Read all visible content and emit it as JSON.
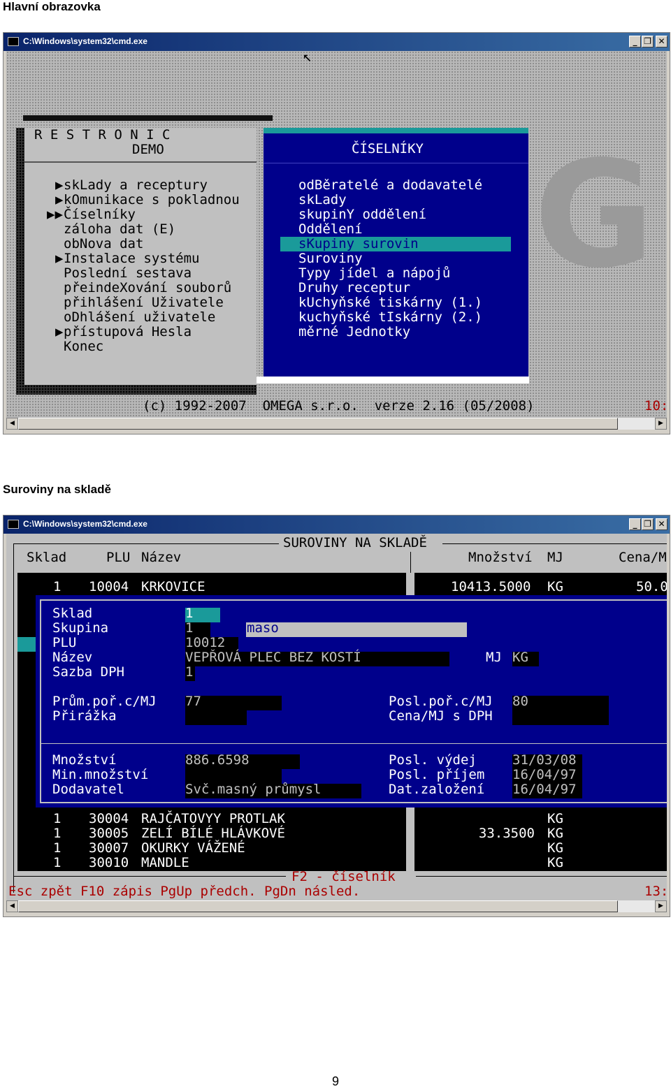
{
  "screen1": {
    "heading": "Hlavní obrazovka",
    "window_title": "C:\\Windows\\system32\\cmd.exe",
    "app_title": "R E S T R O N I C",
    "app_subtitle": "DEMO",
    "main_menu": [
      {
        "marker": "▶",
        "label": "skLady a receptury"
      },
      {
        "marker": "▶",
        "label": "kOmunikace s pokladnou"
      },
      {
        "marker": "▶▶",
        "label": "Číselníky"
      },
      {
        "marker": "",
        "label": "záloha dat (E)"
      },
      {
        "marker": "",
        "label": "obNova dat"
      },
      {
        "marker": "▶",
        "label": "Instalace systému"
      },
      {
        "marker": "",
        "label": "Poslední sestava"
      },
      {
        "marker": "",
        "label": "přeindeXování souborů"
      },
      {
        "marker": "",
        "label": "přihlášení Uživatele"
      },
      {
        "marker": "",
        "label": "oDhlášení uživatele"
      },
      {
        "marker": "▶",
        "label": "přístupová Hesla"
      },
      {
        "marker": "",
        "label": "Konec"
      }
    ],
    "submenu_title": "ČÍSELNÍKY",
    "submenu": [
      {
        "label": "odBěratelé a dodavatelé",
        "selected": false
      },
      {
        "label": "skLady",
        "selected": false
      },
      {
        "label": "skupinY oddělení",
        "selected": false
      },
      {
        "label": "Oddělení",
        "selected": false
      },
      {
        "label": "sKupiny surovin",
        "selected": true
      },
      {
        "label": "Suroviny",
        "selected": false
      },
      {
        "label": "Typy jídel a nápojů",
        "selected": false
      },
      {
        "label": "Druhy receptur",
        "selected": false
      },
      {
        "label": "kUchyňské tiskárny (1.)",
        "selected": false
      },
      {
        "label": "kuchyňské tIskárny (2.)",
        "selected": false
      },
      {
        "label": "měrné Jednotky",
        "selected": false
      }
    ],
    "footer_text": "(c) 1992-2007  OMEGA s.r.o.  verze 2.16 (05/2008)",
    "clock": "10:",
    "background_logo": "GP"
  },
  "screen2": {
    "heading": "Suroviny na skladě",
    "window_title": "C:\\Windows\\system32\\cmd.exe",
    "panel_title": "SUROVINY NA SKLADĚ",
    "columns": {
      "sklad": "Sklad",
      "plu": "PLU",
      "nazev": "Název",
      "mnozstvi": "Množství",
      "mj": "MJ",
      "cena": "Cena/M"
    },
    "top_row": {
      "sklad": "1",
      "plu": "10004",
      "nazev": "KRKOVICE",
      "mnozstvi": "10413.5000",
      "mj": "KG",
      "cena": "50.0"
    },
    "detail": {
      "sklad_label": "Sklad",
      "sklad_value": "1",
      "skupina_label": "Skupina",
      "skupina_value": "1",
      "skupina_name": "maso",
      "plu_label": "PLU",
      "plu_value": "10012",
      "nazev_label": "Název",
      "nazev_value": "VEPŘOVÁ PLEC BEZ KOSTÍ",
      "mj_label": "MJ",
      "mj_value": "KG",
      "dph_label": "Sazba DPH",
      "dph_value": "1",
      "prum_label": "Prům.poř.c/MJ",
      "prum_value": "77",
      "posl_por_label": "Posl.poř.c/MJ",
      "posl_por_value": "80",
      "prirazka_label": "Přirážka",
      "prirazka_value": "",
      "cena_dph_label": "Cena/MJ s DPH",
      "cena_dph_value": "",
      "mnozstvi_label": "Množství",
      "mnozstvi_value": "886.6598",
      "min_label": "Min.množství",
      "min_value": "",
      "dodavatel_label": "Dodavatel",
      "dodavatel_value": "Svč.masný průmysl",
      "posl_vydej_label": "Posl. výdej",
      "posl_vydej_value": "31/03/08",
      "posl_prijem_label": "Posl. příjem",
      "posl_prijem_value": "16/04/97",
      "zalozeni_label": "Dat.založení",
      "zalozeni_value": "16/04/97"
    },
    "rows": [
      {
        "sklad": "1",
        "plu": "30004",
        "nazev": "RAJČATOVYY PROTLAK",
        "mnozstvi": "",
        "mj": "KG"
      },
      {
        "sklad": "1",
        "plu": "30005",
        "nazev": "ZELÍ BÍLÉ HLÁVKOVÉ",
        "mnozstvi": "33.3500",
        "mj": "KG"
      },
      {
        "sklad": "1",
        "plu": "30007",
        "nazev": "OKURKY VÁŽENÉ",
        "mnozstvi": "",
        "mj": "KG"
      },
      {
        "sklad": "1",
        "plu": "30010",
        "nazev": "MANDLE",
        "mnozstvi": "",
        "mj": "KG"
      }
    ],
    "f2_hint": "F2 - číselník",
    "keys_line": "Esc zpět F10 zápis PgUp předch. PgDn násled.",
    "clock": "13:"
  },
  "page_number": "9"
}
